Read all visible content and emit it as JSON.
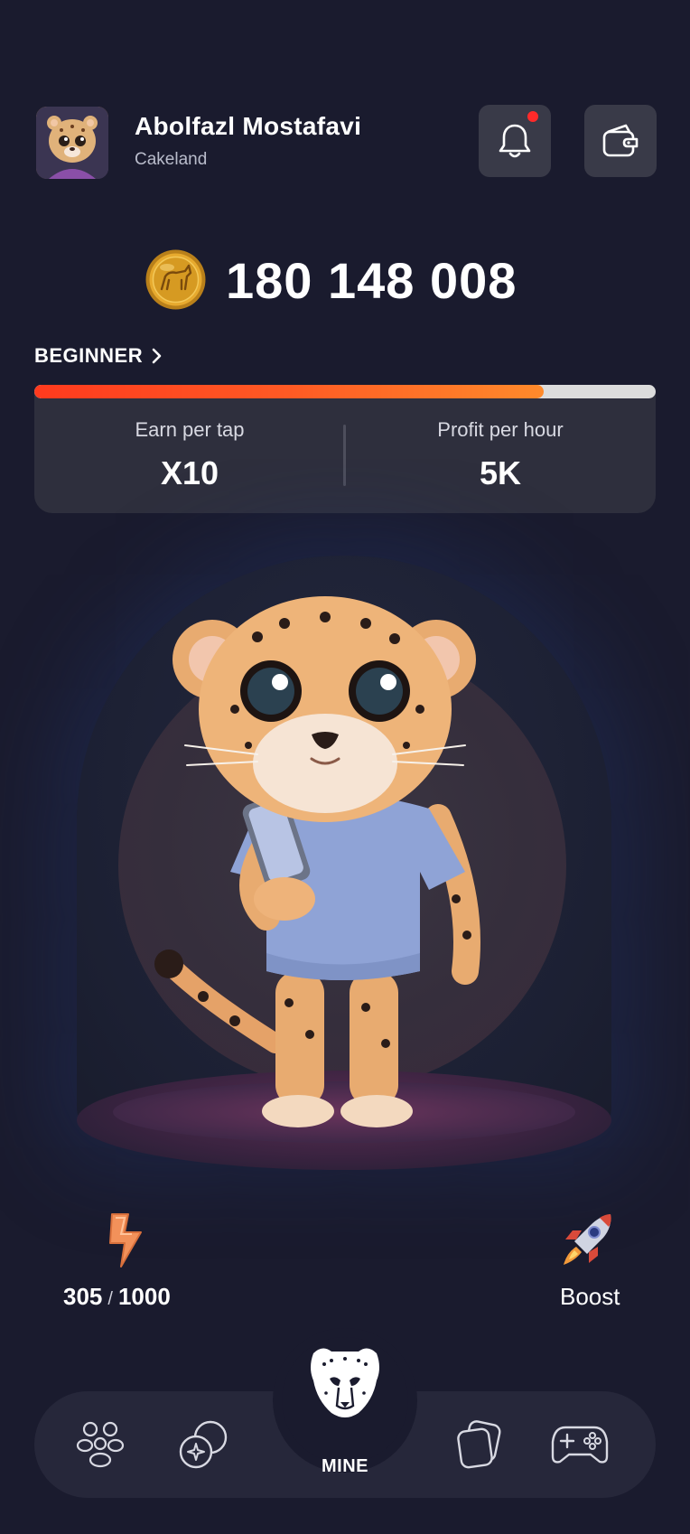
{
  "profile": {
    "name": "Abolfazl Mostafavi",
    "subtitle": "Cakeland",
    "avatar_icon": "cheetah-avatar"
  },
  "header": {
    "notification_icon": "bell-icon",
    "wallet_icon": "wallet-icon",
    "has_unread_notifications": true
  },
  "balance": {
    "coin_icon": "gold-coin-icon",
    "amount": "180 148 008"
  },
  "level": {
    "name": "BEGINNER",
    "progress": 0.82
  },
  "stats": {
    "earn_per_tap_label": "Earn per tap",
    "earn_per_tap_value": "X10",
    "profit_per_hour_label": "Profit per hour",
    "profit_per_hour_value": "5K"
  },
  "energy": {
    "current": "305",
    "separator": "/",
    "max": "1000"
  },
  "boost": {
    "label": "Boost"
  },
  "nav": {
    "mine_label": "MINE"
  },
  "colors": {
    "background": "#1a1b2e",
    "card": "#2e2f3d",
    "accent_start": "#ff3a1e",
    "accent_end": "#ff8a2b",
    "notification_dot": "#ff2a2a"
  }
}
